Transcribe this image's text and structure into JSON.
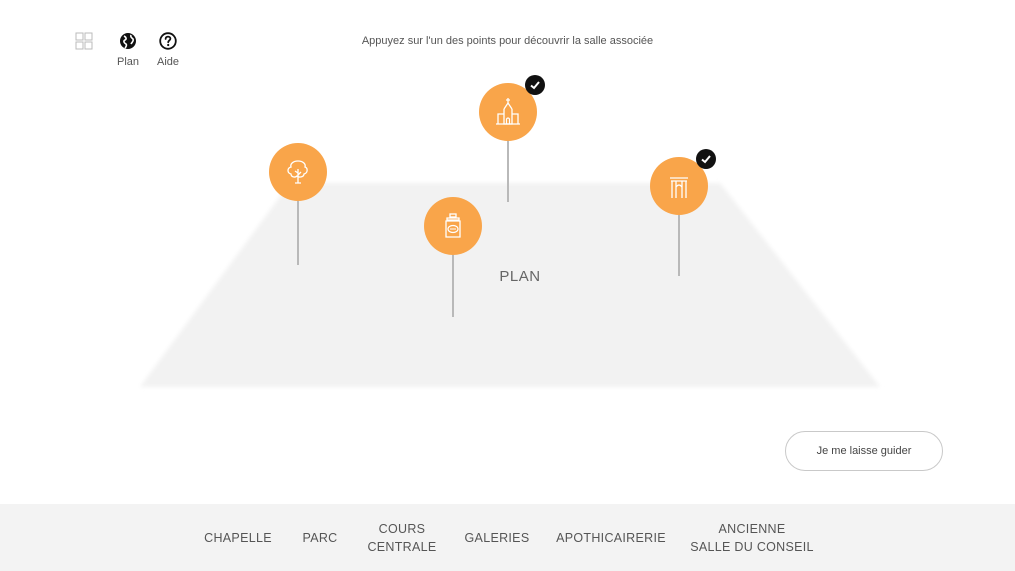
{
  "toolbar": {
    "items": [
      {
        "id": "grid",
        "icon": "grid-icon",
        "label": ""
      },
      {
        "id": "plan",
        "icon": "globe-icon",
        "label": "Plan"
      },
      {
        "id": "aide",
        "icon": "help-icon",
        "label": "Aide"
      }
    ]
  },
  "instruction": "Appuyez sur l'un des points pour découvrir la salle associée",
  "plan": {
    "label": "PLAN",
    "pins": [
      {
        "id": "parc",
        "icon": "tree-icon",
        "visited": false
      },
      {
        "id": "apothicairerie",
        "icon": "apothecary-jar-icon",
        "visited": false
      },
      {
        "id": "chapelle",
        "icon": "chapel-icon",
        "visited": true
      },
      {
        "id": "galeries",
        "icon": "gallery-arch-icon",
        "visited": true
      }
    ]
  },
  "guide_button": {
    "label": "Je me laisse guider"
  },
  "bottom_nav": {
    "items": [
      {
        "label": "CHAPELLE"
      },
      {
        "label": "PARC"
      },
      {
        "label": "COURS\nCENTRALE"
      },
      {
        "label": "GALERIES"
      },
      {
        "label": "APOTHICAIRERIE"
      },
      {
        "label": "ANCIENNE\nSALLE DU CONSEIL"
      }
    ]
  },
  "colors": {
    "accent": "#f9a54a",
    "checkmark_badge": "#111111",
    "plan_floor": "#f2f2f2",
    "nav_background": "#f3f3f3"
  }
}
